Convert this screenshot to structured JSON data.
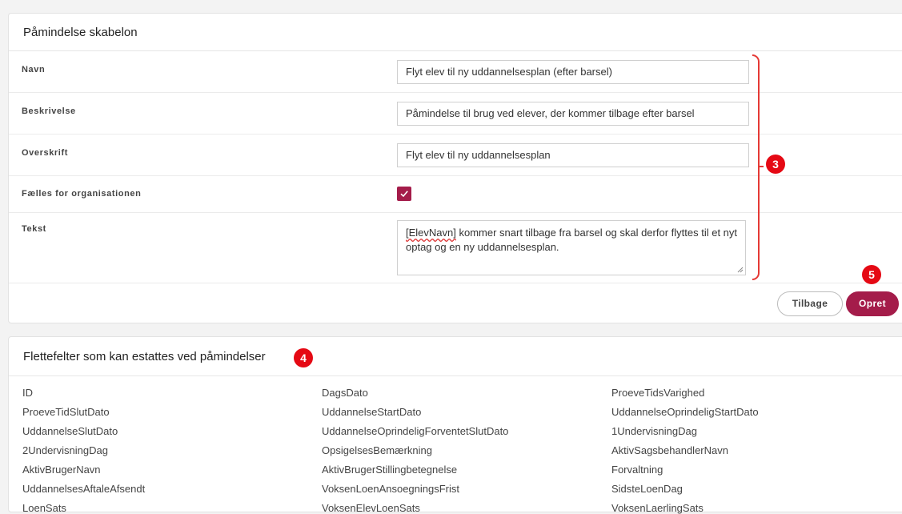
{
  "template_card": {
    "title": "Påmindelse skabelon",
    "fields": {
      "name_label": "Navn",
      "name_value": "Flyt elev til ny uddannelsesplan (efter barsel)",
      "description_label": "Beskrivelse",
      "description_value": "Påmindelse til brug ved elever, der kommer tilbage efter barsel",
      "heading_label": "Overskrift",
      "heading_value": "Flyt elev til ny uddannelsesplan",
      "shared_label": "Fælles for organisationen",
      "shared_checked": true,
      "text_label": "Tekst",
      "text_value_token": "[ElevNavn]",
      "text_value_rest": " kommer snart tilbage fra barsel og skal derfor flyttes til et nyt optag og en ny uddannelsesplan."
    },
    "buttons": {
      "back": "Tilbage",
      "create": "Opret"
    }
  },
  "annotations": {
    "badge_3": "3",
    "badge_4": "4",
    "badge_5": "5"
  },
  "merge_fields_card": {
    "title": "Flettefelter som kan estattes ved påmindelser",
    "items": [
      "ID",
      "DagsDato",
      "ProeveTidsVarighed",
      "ProeveTidSlutDato",
      "UddannelseStartDato",
      "UddannelseOprindeligStartDato",
      "UddannelseSlutDato",
      "UddannelseOprindeligForventetSlutDato",
      "1UndervisningDag",
      "2UndervisningDag",
      "OpsigelsesBemærkning",
      "AktivSagsbehandlerNavn",
      "AktivBrugerNavn",
      "AktivBrugerStillingbetegnelse",
      "Forvaltning",
      "UddannelsesAftaleAfsendt",
      "VoksenLoenAnsoegningsFrist",
      "SidsteLoenDag",
      "LoenSats",
      "VoksenElevLoenSats",
      "VoksenLaerlingSats"
    ]
  },
  "colors": {
    "accent": "#a41c4a",
    "annotation_red": "#e50914"
  }
}
